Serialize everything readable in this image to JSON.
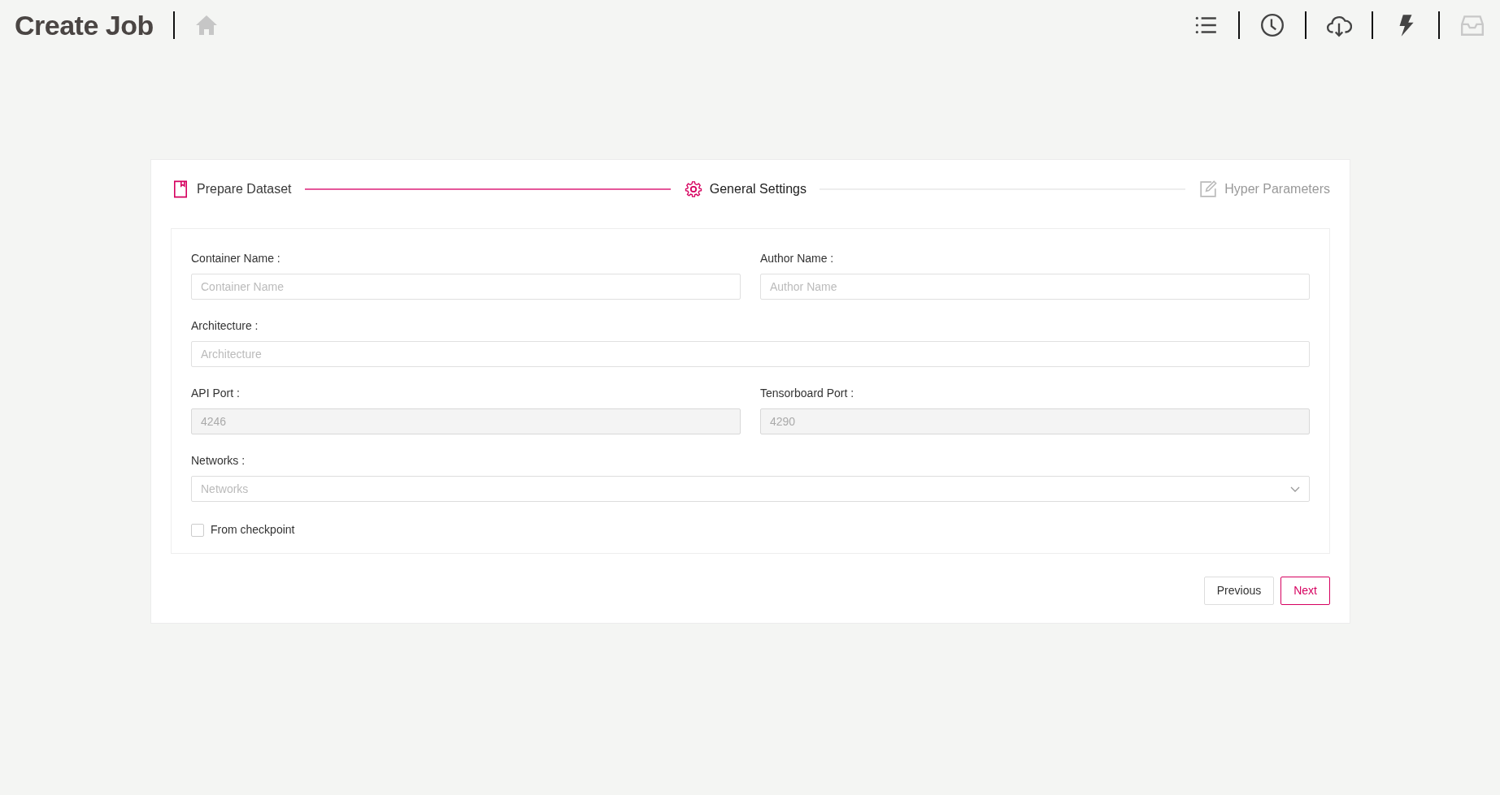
{
  "header": {
    "title": "Create Job",
    "home_disabled": true,
    "toolbar": [
      {
        "disabled": false
      },
      {
        "disabled": false
      },
      {
        "disabled": false
      },
      {
        "disabled": false
      },
      {
        "disabled": true
      }
    ]
  },
  "stepper": [
    {
      "label": "Prepare Dataset",
      "completed": true,
      "selected": false
    },
    {
      "label": "General Settings",
      "completed": false,
      "selected": true
    },
    {
      "label": "Hyper Parameters",
      "completed": false,
      "selected": false
    }
  ],
  "form": {
    "rows": [
      [
        {
          "label": "Container Name :",
          "kind": "text",
          "placeholder": "Container Name"
        },
        {
          "label": "Author Name :",
          "kind": "text",
          "placeholder": "Author Name"
        }
      ],
      [
        {
          "label": "Architecture :",
          "kind": "text",
          "placeholder": "Architecture"
        }
      ],
      [
        {
          "label": "API Port :",
          "kind": "text",
          "value": "4246",
          "disabled": true
        },
        {
          "label": "Tensorboard Port :",
          "kind": "text",
          "value": "4290",
          "disabled": true
        }
      ],
      [
        {
          "label": "Networks :",
          "kind": "select",
          "placeholder": "Networks"
        }
      ]
    ],
    "checkbox": {
      "label": "From checkpoint",
      "checked": false
    }
  },
  "buttons": [
    {
      "label": "Previous",
      "primary": false
    },
    {
      "label": "Next",
      "primary": true
    }
  ]
}
